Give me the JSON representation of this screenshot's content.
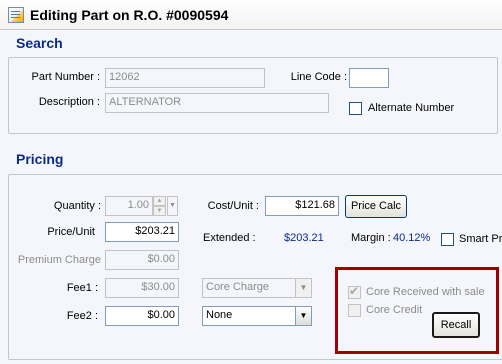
{
  "window": {
    "title": "Editing Part on R.O. #0090594"
  },
  "search": {
    "title": "Search",
    "part_number_label": "Part Number :",
    "part_number_value": "12062",
    "line_code_label": "Line Code :",
    "line_code_value": "",
    "description_label": "Description :",
    "description_value": "ALTERNATOR",
    "alternate_number_label": "Alternate Number",
    "alternate_number_checked": false
  },
  "pricing": {
    "title": "Pricing",
    "quantity_label": "Quantity :",
    "quantity_value": "1.00",
    "cost_unit_label": "Cost/Unit :",
    "cost_unit_value": "$121.68",
    "price_calc_label": "Price Calc",
    "price_unit_label": "Price/Unit",
    "price_unit_value": "$203.21",
    "extended_label": "Extended :",
    "extended_value": "$203.21",
    "margin_label": "Margin :",
    "margin_value": "40.12%",
    "smart_price_label": "Smart Pric",
    "premium_charge_label": "Premium Charge",
    "premium_charge_value": "$0.00",
    "fee1_label": "Fee1 :",
    "fee1_value": "$30.00",
    "fee1_type": "Core Charge",
    "fee2_label": "Fee2 :",
    "fee2_value": "$0.00",
    "fee2_type": "None",
    "core_received_label": "Core Received with sale",
    "core_received_checked": true,
    "core_credit_label": "Core Credit",
    "core_credit_checked": false,
    "recall_label": "Recall"
  },
  "colors": {
    "section_title": "#0a2c86",
    "highlight": "#a00000",
    "value_blue": "#0a2c86"
  },
  "icons": {
    "app": "document-icon",
    "spin_up": "spin-up-icon",
    "spin_down": "spin-down-icon",
    "dropdown": "dropdown-arrow-icon"
  }
}
